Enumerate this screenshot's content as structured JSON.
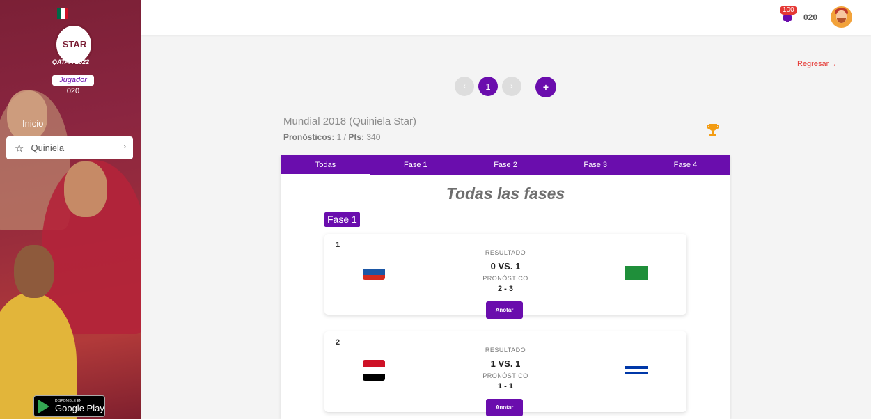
{
  "sidebar": {
    "brand": "STAR",
    "edition": "QATAR 2022",
    "role": "Jugador",
    "code": "020",
    "nav": [
      {
        "label": "Inicio"
      },
      {
        "label": "Quiniela"
      }
    ],
    "store_badge": {
      "small": "DISPONIBLE EN",
      "big": "Google Play"
    }
  },
  "header": {
    "notifications": "100",
    "code": "020"
  },
  "main": {
    "back_label": "Regresar",
    "pager": [
      "‹",
      "1",
      "›"
    ],
    "add_label": "+",
    "quiniela_title": "Mundial 2018 (Quiniela Star)",
    "stats_label": "Pronósticos:",
    "stats_value": " 1 / ",
    "pts_label": "Pts:",
    "pts_value": " 340",
    "tabs": [
      {
        "label": "Todas"
      },
      {
        "label": "Fase 1"
      },
      {
        "label": "Fase 2"
      },
      {
        "label": "Fase 3"
      },
      {
        "label": "Fase 4"
      }
    ],
    "section_title": "Todas las fases",
    "phase_badge": "Fase 1",
    "result_label": "RESULTADO",
    "prediction_label": "PRONÓSTICO",
    "action_label": "Anotar",
    "matches": [
      {
        "number": "1",
        "score": "0  VS.  1",
        "prediction": "2 - 3",
        "home_flag": "russia-flag",
        "away_flag": "saudi-arabia-flag"
      },
      {
        "number": "2",
        "score": "1  VS.  1",
        "prediction": "1 - 1",
        "home_flag": "egypt-flag",
        "away_flag": "uruguay-flag"
      }
    ]
  },
  "colors": {
    "accent": "#6a0dad",
    "danger": "#e53935",
    "trophy": "#f39c12"
  }
}
